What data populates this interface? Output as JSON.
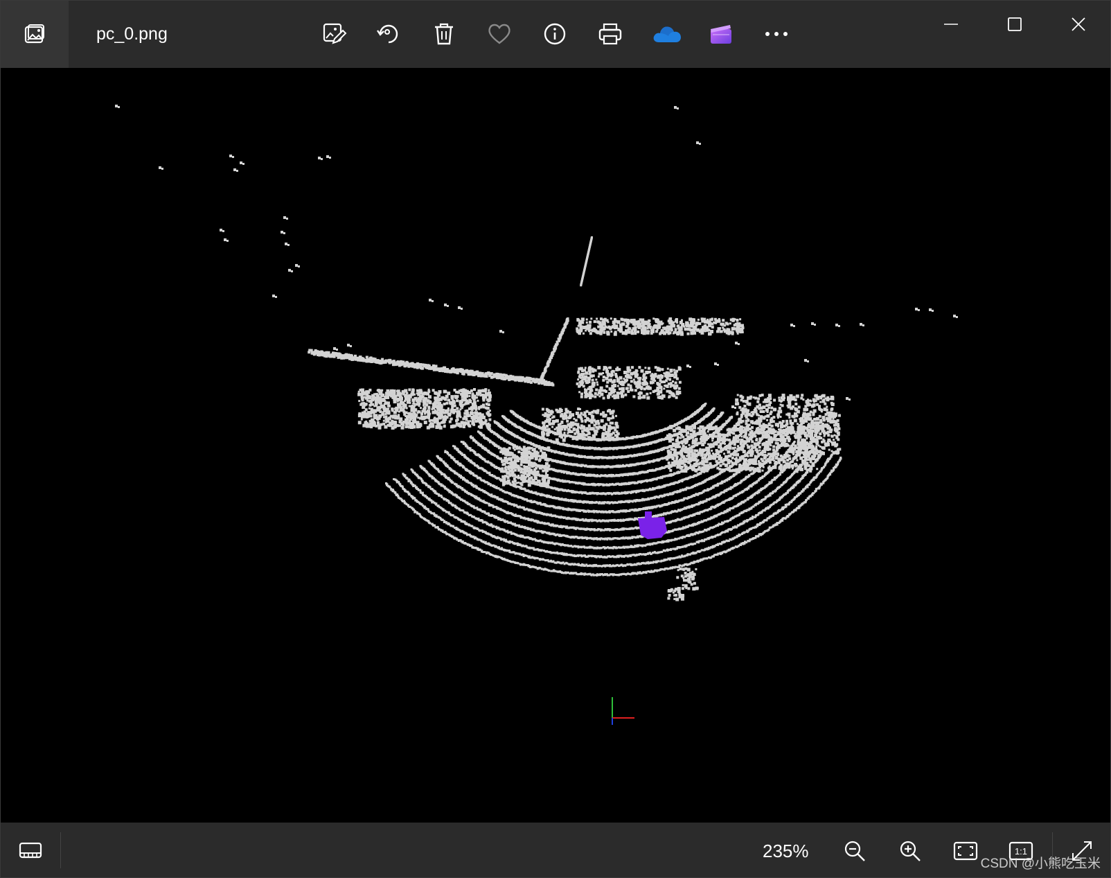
{
  "window": {
    "filename": "pc_0.png"
  },
  "toolbar": {
    "buttons": [
      {
        "name": "edit-image-button",
        "icon": "edit-image-icon"
      },
      {
        "name": "rotate-button",
        "icon": "rotate-icon"
      },
      {
        "name": "delete-button",
        "icon": "trash-icon"
      },
      {
        "name": "favorite-button",
        "icon": "heart-icon"
      },
      {
        "name": "file-info-button",
        "icon": "info-icon"
      },
      {
        "name": "print-button",
        "icon": "printer-icon"
      },
      {
        "name": "onedrive-button",
        "icon": "onedrive-cloud-icon"
      },
      {
        "name": "clipchamp-button",
        "icon": "clipchamp-icon"
      },
      {
        "name": "see-more-button",
        "icon": "more-dots-icon"
      }
    ]
  },
  "window_controls": [
    "minimize-icon",
    "maximize-icon",
    "close-icon"
  ],
  "status": {
    "zoom": "235%",
    "buttons": [
      "filmstrip-icon",
      "zoom-out-icon",
      "zoom-in-icon",
      "fit-to-window-icon",
      "actual-size-icon",
      "full-screen-icon"
    ],
    "actual_size_label": "1:1"
  },
  "watermark": "CSDN @小熊吃玉米",
  "colors": {
    "titlebar": "#2b2b2b",
    "canvas": "#000000",
    "points": "#d3d3d3",
    "highlight": "#7a22e8",
    "onedrive": "#1f7fe0"
  }
}
